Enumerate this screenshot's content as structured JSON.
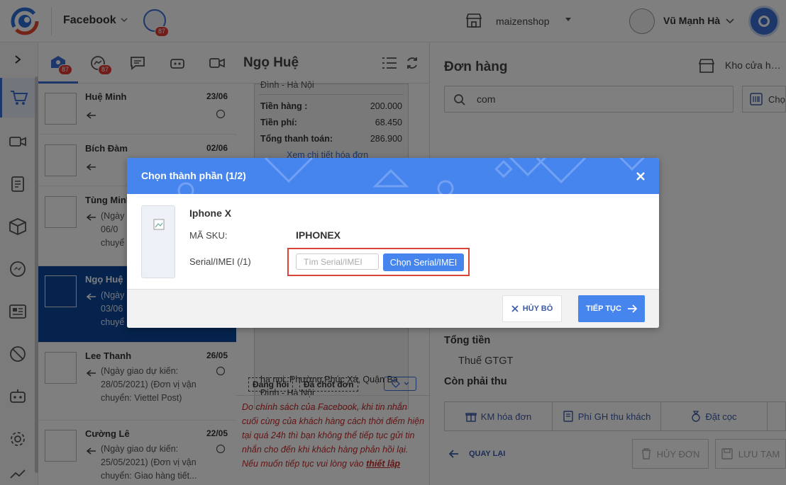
{
  "topbar": {
    "channel": "Facebook",
    "channel_badge": "87",
    "shop": "maizenshop",
    "user": "Vũ Mạnh Hà"
  },
  "conv_tabs": {
    "inbox_badge": "87",
    "messenger_badge": "87"
  },
  "conversations": [
    {
      "name": "Huệ Minh",
      "date": "23/06",
      "snippet": ""
    },
    {
      "name": "Bích Đàm",
      "date": "02/06",
      "snippet": ""
    },
    {
      "name": "Tùng Minh",
      "date": "",
      "snippet": "(Ngày 06/0 chuyể"
    },
    {
      "name": "Ngọ Huệ",
      "date": "",
      "snippet": "(Ngày 03/06 chuyể"
    },
    {
      "name": "Lee Thanh",
      "date": "26/05",
      "snippet": "(Ngày giao dự kiến: 28/05/2021) (Đơn vị vận chuyển: Viettel Post)"
    },
    {
      "name": "Cường Lê",
      "date": "22/05",
      "snippet": "(Ngày giao dự kiến: 25/05/2021) (Đơn vị vận chuyển: Giao hàng tiết..."
    }
  ],
  "chat": {
    "title": "Ngọ Huệ",
    "partial_top": "Đình - Hà Nội",
    "rows": [
      {
        "label": "Tiền hàng :",
        "value": "200.000"
      },
      {
        "label": "Tiền phí:",
        "value": "68.450"
      },
      {
        "label": "Tổng thanh toán:",
        "value": "286.900"
      }
    ],
    "link_partial": "Xem chi tiết hóa đơn",
    "address": "ha noi, Phường Phúc Xá, Quận Ba Đình - Hà Nội",
    "tags": [
      "Đang hỏi",
      "Đã chốt đơn"
    ],
    "warning": "Do chính sách của Facebook, khi tin nhắn cuối cùng của khách hàng cách thời điểm hiện tại quá 24h thì bạn không thể tiếp tục gửi tin nhắn cho đến khi khách hàng phản hồi lại. Nếu muốn tiếp tục vui lòng vào ",
    "warning_link": "thiết lập"
  },
  "order": {
    "title": "Đơn hàng",
    "store": "Kho cửa hàng",
    "search_value": "com",
    "choose_btn": "Chọ",
    "total_label": "Tổng tiền",
    "vat_label": "Thuế GTGT",
    "due_label": "Còn phải thu",
    "tabs": [
      "KM hóa đơn",
      "Phí GH thu khách",
      "Đặt cọc"
    ],
    "back": "QUAY LẠI",
    "cancel_order": "HỦY ĐƠN",
    "save_draft": "LƯU TẠM"
  },
  "modal": {
    "title": "Chọn thành phần (1/2)",
    "product_name": "Iphone X",
    "sku_label": "MÃ SKU:",
    "sku_value": "IPHONEX",
    "serial_label": "Serial/IMEI (/1)",
    "serial_placeholder": "Tìm Serial/IMEI",
    "serial_button": "Chọn Serial/IMEI",
    "cancel": "HỦY BỎ",
    "continue": "TIẾP TỤC"
  },
  "colors": {
    "accent": "#4684ee",
    "selected_row": "#0b4699",
    "highlight": "#d9443a"
  }
}
